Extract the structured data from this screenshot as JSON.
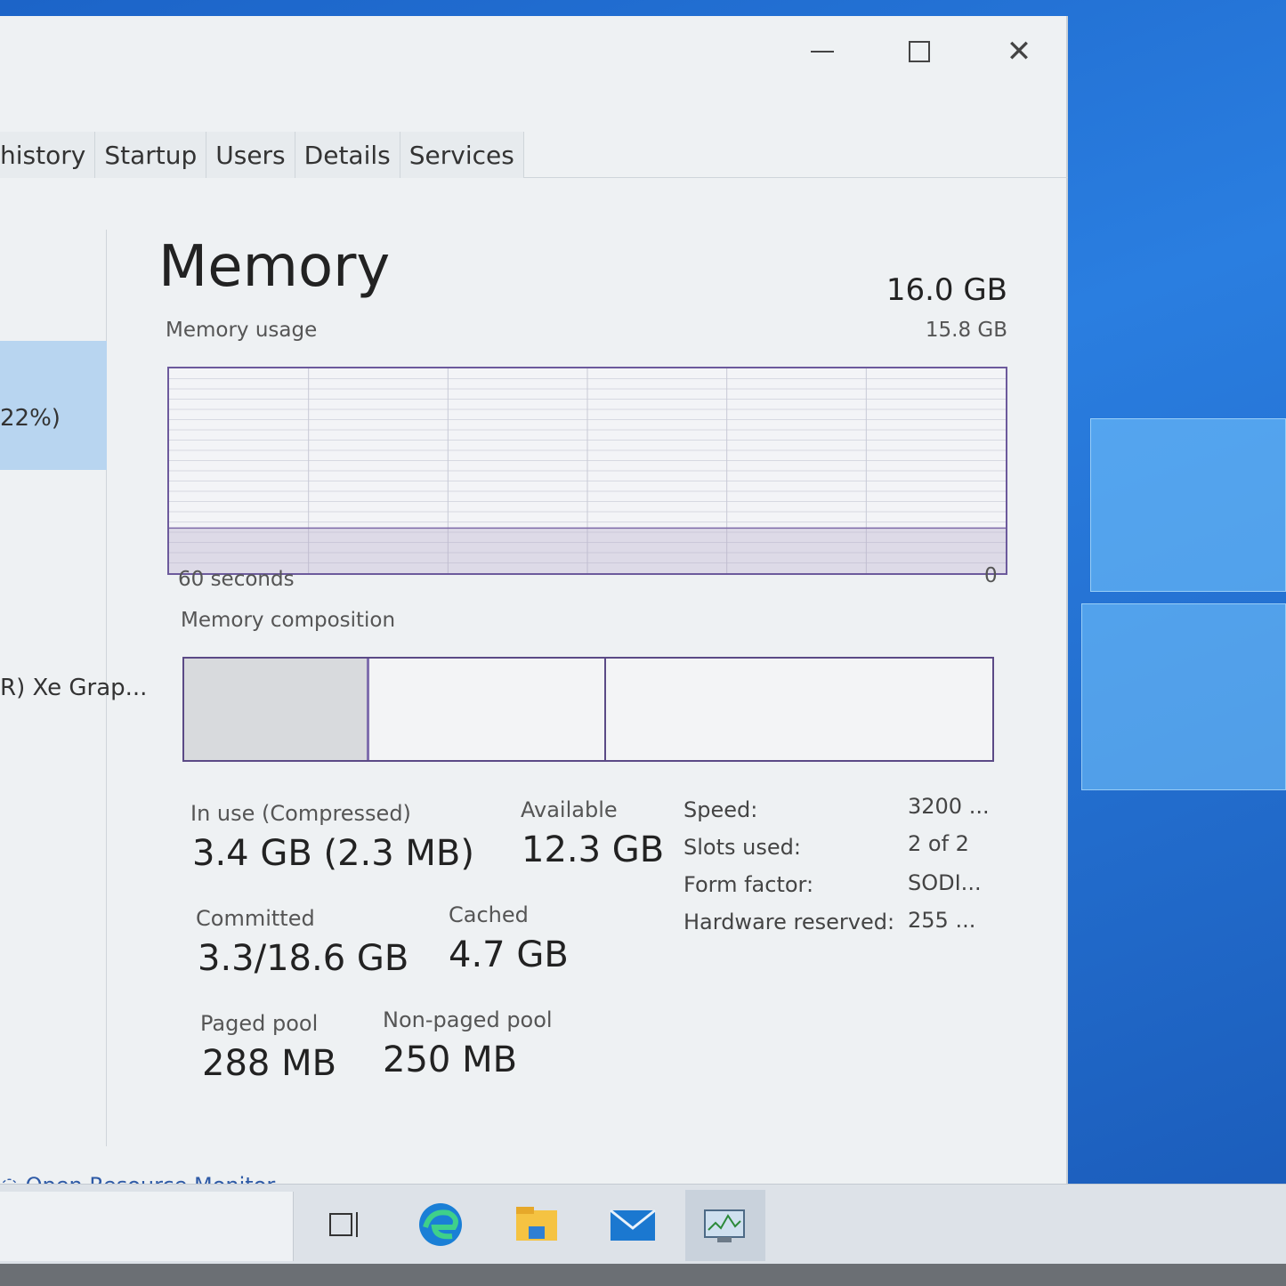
{
  "window": {
    "controls": {
      "minimize": "minimize",
      "maximize": "maximize",
      "close": "close"
    }
  },
  "tabs": [
    {
      "label": "history"
    },
    {
      "label": "Startup"
    },
    {
      "label": "Users"
    },
    {
      "label": "Details"
    },
    {
      "label": "Services"
    }
  ],
  "sidebar": {
    "selected_fragment": "22%)",
    "gpu_fragment": "R) Xe Grap..."
  },
  "memory": {
    "title": "Memory",
    "total": "16.0 GB",
    "usage_label": "Memory usage",
    "usage_max": "15.8 GB",
    "time_start": "60 seconds",
    "time_end": "0",
    "composition_label": "Memory composition",
    "usage_fraction": 0.22
  },
  "stats": {
    "in_use_label": "In use (Compressed)",
    "in_use_value": "3.4 GB (2.3 MB)",
    "available_label": "Available",
    "available_value": "12.3 GB",
    "committed_label": "Committed",
    "committed_value": "3.3/18.6 GB",
    "cached_label": "Cached",
    "cached_value": "4.7 GB",
    "paged_label": "Paged pool",
    "paged_value": "288 MB",
    "nonpaged_label": "Non-paged pool",
    "nonpaged_value": "250 MB"
  },
  "specs": [
    {
      "key": "Speed:",
      "value": "3200 ..."
    },
    {
      "key": "Slots used:",
      "value": "2 of 2"
    },
    {
      "key": "Form factor:",
      "value": "SODI..."
    },
    {
      "key": "Hardware reserved:",
      "value": "255 ..."
    }
  ],
  "footer": {
    "resource_monitor": "Open Resource Monitor"
  },
  "taskbar": {
    "icons": [
      "task-view-icon",
      "edge-icon",
      "file-explorer-icon",
      "mail-icon",
      "task-manager-icon"
    ]
  }
}
